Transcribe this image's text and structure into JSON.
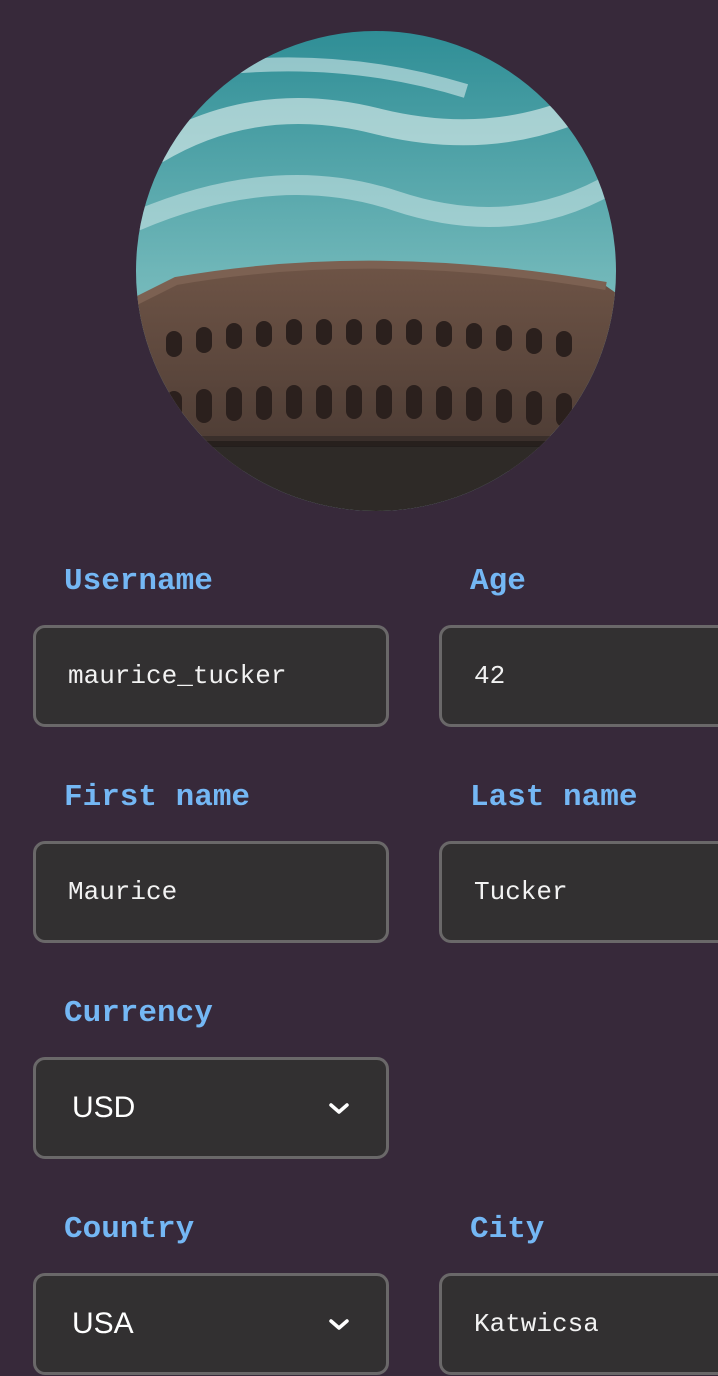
{
  "avatar": {
    "alt_icon": "colosseum-photo"
  },
  "form": {
    "username": {
      "label": "Username",
      "value": "maurice_tucker"
    },
    "age": {
      "label": "Age",
      "value": "42"
    },
    "first_name": {
      "label": "First name",
      "value": "Maurice"
    },
    "last_name": {
      "label": "Last name",
      "value": "Tucker"
    },
    "currency": {
      "label": "Currency",
      "value": "USD",
      "options": [
        "USD"
      ]
    },
    "country": {
      "label": "Country",
      "value": "USA",
      "options": [
        "USA"
      ]
    },
    "city": {
      "label": "City",
      "value": "Katwicsa"
    }
  },
  "colors": {
    "background": "#37293a",
    "label": "#74b7f4",
    "field_bg": "#323031",
    "field_border": "#6a6869"
  }
}
